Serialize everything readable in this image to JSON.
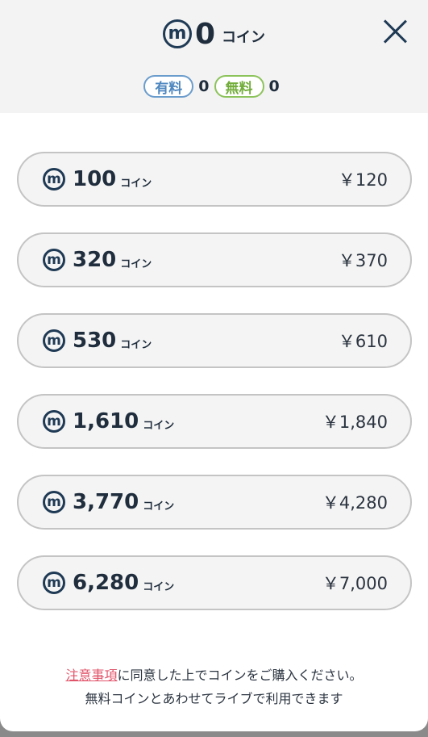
{
  "header": {
    "balance": "0",
    "balance_unit": "コイン",
    "coin_icon_glyph": "m",
    "paid_label": "有料",
    "paid_value": "0",
    "free_label": "無料",
    "free_value": "0",
    "close_icon": "close-x-icon"
  },
  "packages": [
    {
      "amount": "100",
      "unit": "コイン",
      "price": "￥120"
    },
    {
      "amount": "320",
      "unit": "コイン",
      "price": "￥370"
    },
    {
      "amount": "530",
      "unit": "コイン",
      "price": "￥610"
    },
    {
      "amount": "1,610",
      "unit": "コイン",
      "price": "￥1,840"
    },
    {
      "amount": "3,770",
      "unit": "コイン",
      "price": "￥4,280"
    },
    {
      "amount": "6,280",
      "unit": "コイン",
      "price": "￥7,000"
    }
  ],
  "notice": {
    "link_text": "注意事項",
    "line1_rest": "に同意した上でコインをご購入ください。",
    "line2": "無料コインとあわせてライブで利用できます"
  },
  "colors": {
    "accent_navy": "#1f3a55",
    "paid_blue": "#4f87bf",
    "free_green": "#72ad3b",
    "link_red": "#e0546a"
  }
}
